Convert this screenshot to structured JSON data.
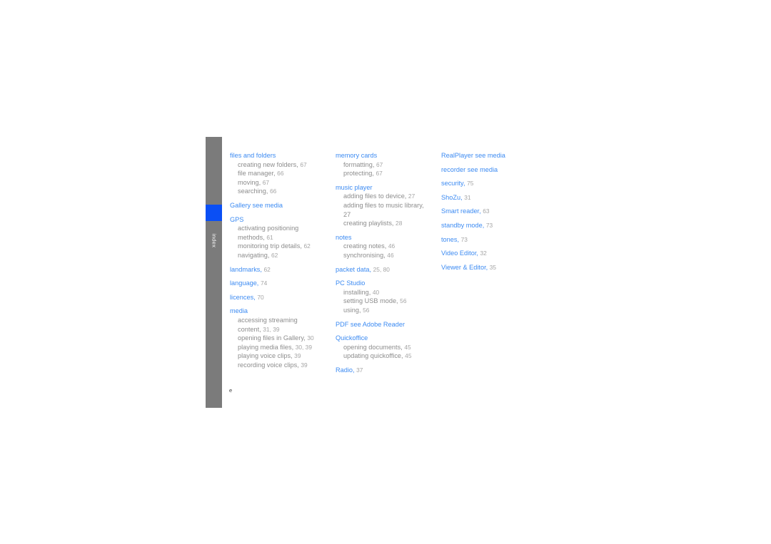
{
  "side_tab": {
    "label": "index",
    "marker_color": "#0a4ff5",
    "bar_color": "#7b7b7b"
  },
  "folio": "e",
  "colors": {
    "heading": "#3d8bf2",
    "subentry": "#8d8d8d",
    "page_number": "#a5a5a5"
  },
  "columns": [
    {
      "entries": [
        {
          "title": "files and folders",
          "page": "",
          "subitems": [
            {
              "text": "creating new folders,",
              "page": "67"
            },
            {
              "text": "file manager,",
              "page": "66"
            },
            {
              "text": "moving,",
              "page": "67"
            },
            {
              "text": "searching,",
              "page": "66"
            }
          ]
        },
        {
          "title": "Gallery see media",
          "page": "",
          "subitems": []
        },
        {
          "title": "GPS",
          "page": "",
          "subitems": [
            {
              "text": "activating positioning",
              "page": ""
            },
            {
              "text": "methods,",
              "page": "61"
            },
            {
              "text": "monitoring trip details,",
              "page": "62"
            },
            {
              "text": "navigating,",
              "page": "62"
            }
          ]
        },
        {
          "title": "landmarks,",
          "page": "62",
          "subitems": []
        },
        {
          "title": "language,",
          "page": "74",
          "subitems": []
        },
        {
          "title": "licences,",
          "page": "70",
          "subitems": []
        },
        {
          "title": "media",
          "page": "",
          "subitems": [
            {
              "text": "accessing streaming",
              "page": ""
            },
            {
              "text": "content,",
              "page": "31,  39"
            },
            {
              "text": "opening files in Gallery,",
              "page": "30"
            },
            {
              "text": "playing media files,",
              "page": "30,  39"
            },
            {
              "text": "playing voice clips,",
              "page": "39"
            },
            {
              "text": "recording voice clips,",
              "page": "39"
            }
          ]
        }
      ]
    },
    {
      "entries": [
        {
          "title": "memory cards",
          "page": "",
          "subitems": [
            {
              "text": "formatting,",
              "page": "67"
            },
            {
              "text": "protecting,",
              "page": "67"
            }
          ]
        },
        {
          "title": "music player",
          "page": "",
          "subitems": [
            {
              "text": "adding files to device,",
              "page": "27"
            },
            {
              "text": "adding files to music library,",
              "page": ""
            },
            {
              "text": "27",
              "page": ""
            },
            {
              "text": "creating playlists,",
              "page": "28"
            }
          ]
        },
        {
          "title": "notes",
          "page": "",
          "subitems": [
            {
              "text": "creating notes,",
              "page": "46"
            },
            {
              "text": "synchronising,",
              "page": "46"
            }
          ]
        },
        {
          "title": "packet data,",
          "page": "25,  80",
          "subitems": []
        },
        {
          "title": "PC Studio",
          "page": "",
          "subitems": [
            {
              "text": "installing,",
              "page": "40"
            },
            {
              "text": "setting USB mode,",
              "page": "56"
            },
            {
              "text": "using,",
              "page": "56"
            }
          ]
        },
        {
          "title": "PDF see Adobe Reader",
          "page": "",
          "subitems": []
        },
        {
          "title": "Quickoffice",
          "page": "",
          "subitems": [
            {
              "text": "opening documents,",
              "page": "45"
            },
            {
              "text": "updating quickoffice,",
              "page": "45"
            }
          ]
        },
        {
          "title": "Radio,",
          "page": "37",
          "subitems": []
        }
      ]
    },
    {
      "entries": [
        {
          "title": "RealPlayer see media",
          "page": "",
          "subitems": []
        },
        {
          "title": "recorder see media",
          "page": "",
          "subitems": []
        },
        {
          "title": "security,",
          "page": "75",
          "subitems": []
        },
        {
          "title": "ShoZu,",
          "page": "31",
          "subitems": []
        },
        {
          "title": "Smart reader,",
          "page": "63",
          "subitems": []
        },
        {
          "title": "standby mode,",
          "page": "73",
          "subitems": []
        },
        {
          "title": "tones,",
          "page": "73",
          "subitems": []
        },
        {
          "title": "Video Editor,",
          "page": "32",
          "subitems": []
        },
        {
          "title": "Viewer & Editor,",
          "page": "35",
          "subitems": []
        }
      ]
    }
  ]
}
